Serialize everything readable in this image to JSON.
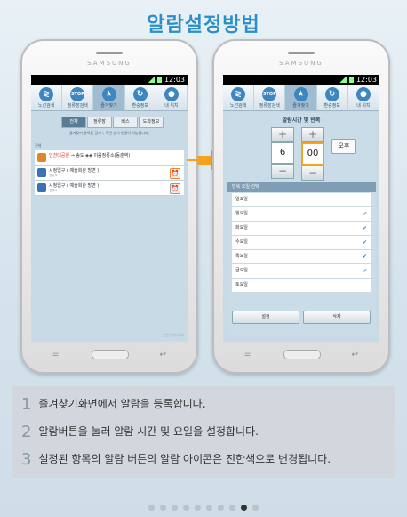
{
  "title": "알람설정방법",
  "phone": {
    "brand": "SAMSUNG",
    "time": "12:03"
  },
  "nav": [
    {
      "icon": "route-icon",
      "label": "노선검색"
    },
    {
      "icon": "stop-icon",
      "label": "정류장검색",
      "badge": "STOP"
    },
    {
      "icon": "star-icon",
      "label": "즐겨찾기"
    },
    {
      "icon": "transfer-icon",
      "label": "환승정보"
    },
    {
      "icon": "location-icon",
      "label": "내 위치"
    }
  ],
  "left_screen": {
    "tabs": [
      "전체",
      "정류장",
      "버스",
      "도착정보"
    ],
    "hint": "즐겨찾기 항목을 길게 누르면 순서 변경이 가능합니다.",
    "list_header": "전체",
    "items": [
      {
        "type": "bus",
        "title_red": "인천대공원",
        "title": "→ 송도 ◈◈ 이음정류소(동춘역)",
        "sub": ""
      },
      {
        "type": "stop",
        "title": "시청입구 ( 예술회관 방면 )",
        "sub": "정류소"
      },
      {
        "type": "stop",
        "title": "시청입구 ( 예술회관 방면 )",
        "sub": "정류소"
      }
    ],
    "footer": "인천 버스정보"
  },
  "right_screen": {
    "dialog_title": "알람시간 및 반복",
    "hour": "6",
    "minute": "00",
    "ampm": "오후",
    "plus": "+",
    "minus": "−",
    "repeat_header": "반복 요일 선택",
    "days": [
      {
        "label": "일요일",
        "checked": false
      },
      {
        "label": "월요일",
        "checked": true
      },
      {
        "label": "화요일",
        "checked": true
      },
      {
        "label": "수요일",
        "checked": true
      },
      {
        "label": "목요일",
        "checked": true
      },
      {
        "label": "금요일",
        "checked": true
      },
      {
        "label": "토요일",
        "checked": false
      }
    ],
    "check_mark": "✔",
    "btn_set": "설정",
    "btn_delete": "삭제"
  },
  "steps": [
    {
      "num": "1",
      "text": "즐겨찾기화면에서 알람을 등록합니다."
    },
    {
      "num": "2",
      "text": "알람버튼을 눌러 알람 시간 및 요일을 설정합니다."
    },
    {
      "num": "3",
      "text": "설정된 항목의 알람 버튼의 알람 아이콘은 진한색으로 변경됩니다."
    }
  ],
  "pagination": {
    "count": 10,
    "active": 9
  }
}
